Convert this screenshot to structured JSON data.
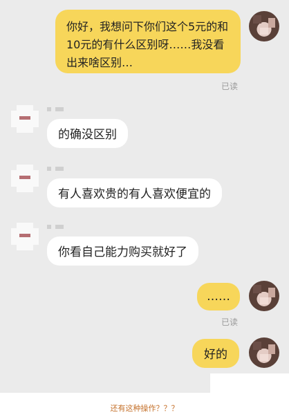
{
  "messages": [
    {
      "side": "me",
      "text": "你好，我想问下你们这个5元的和10元的有什么区别呀……我没看出来啥区别…",
      "read_label": "已读"
    },
    {
      "side": "other",
      "text": "的确没区别"
    },
    {
      "side": "other",
      "text": "有人喜欢贵的有人喜欢便宜的"
    },
    {
      "side": "other",
      "text": "你看自己能力购买就好了"
    },
    {
      "side": "me",
      "text": "……",
      "read_label": "已读"
    },
    {
      "side": "me",
      "text": "好的"
    }
  ],
  "caption": "还有这种操作？？？",
  "colors": {
    "my_bubble": "#f7d65a",
    "other_bubble": "#ffffff",
    "background": "#ebebeb",
    "read_label": "#9a9a9a",
    "caption": "#c4702a"
  }
}
